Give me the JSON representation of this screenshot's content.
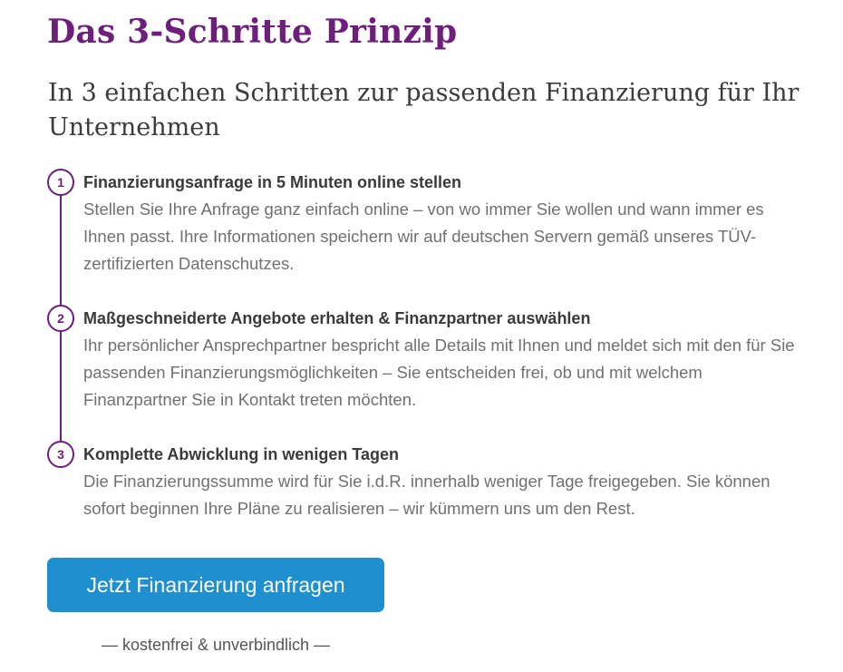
{
  "header": {
    "title": "Das 3-Schritte Prinzip",
    "subtitle": "In 3 einfachen Schritten zur passenden Finanzierung für Ihr Unternehmen"
  },
  "steps": [
    {
      "number": "1",
      "title": "Finanzierungsanfrage in 5 Minuten online stellen",
      "text": "Stellen Sie Ihre Anfrage ganz einfach online – von wo immer Sie wollen und wann immer es Ihnen passt. Ihre Informationen speichern wir auf deutschen Servern gemäß unseres TÜV-zertifizierten Datenschutzes."
    },
    {
      "number": "2",
      "title": "Maßgeschneiderte Angebote erhalten & Finanzpartner auswählen",
      "text": "Ihr persönlicher Ansprechpartner bespricht alle Details mit Ihnen und meldet sich mit den für Sie passenden Finanzierungsmöglichkeiten – Sie entscheiden frei, ob und mit welchem Finanzpartner Sie in Kontakt treten möchten."
    },
    {
      "number": "3",
      "title": "Komplette Abwicklung in wenigen Tagen",
      "text": "Die Finanzierungssumme wird für Sie i.d.R. innerhalb weniger Tage freigegeben. Sie können sofort beginnen Ihre Pläne zu realisieren – wir kümmern uns um den Rest."
    }
  ],
  "cta": {
    "button_label": "Jetzt Finanzierung anfragen",
    "note": "— kostenfrei & unverbindlich —"
  },
  "colors": {
    "accent": "#6d1f7b",
    "button": "#1f8fd0",
    "heading_text": "#3a3a3a",
    "body_text": "#707070"
  }
}
